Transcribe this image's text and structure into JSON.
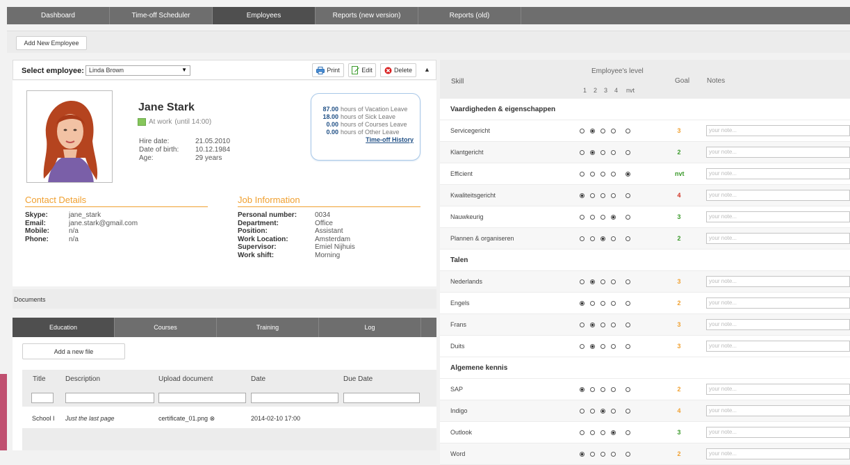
{
  "nav": {
    "tabs": [
      "Dashboard",
      "Time-off Scheduler",
      "Employees",
      "Reports (new version)",
      "Reports (old)"
    ],
    "active": 2
  },
  "toolbar": {
    "add_employee": "Add New Employee"
  },
  "selector": {
    "label": "Select employee:",
    "value": "Linda Brown",
    "print": "Print",
    "edit": "Edit",
    "delete": "Delete",
    "collapse": "▲"
  },
  "profile": {
    "name": "Jane Stark",
    "status": "At work",
    "status_until": "(until 14:00)",
    "hire_label": "Hire date:",
    "hire": "21.05.2010",
    "dob_label": "Date of birth:",
    "dob": "10.12.1984",
    "age_label": "Age:",
    "age": "29 years"
  },
  "leave": {
    "rows": [
      {
        "hours": "87.00",
        "text": "hours of Vacation Leave"
      },
      {
        "hours": "18.00",
        "text": "hours of Sick Leave"
      },
      {
        "hours": "0.00",
        "text": "hours of Courses Leave"
      },
      {
        "hours": "0.00",
        "text": "hours of Other Leave"
      }
    ],
    "history_link": "Time-off History"
  },
  "contact": {
    "title": "Contact Details",
    "skype_k": "Skype:",
    "skype": "jane_stark",
    "email_k": "Email:",
    "email": "jane.stark@gmail.com",
    "mobile_k": "Mobile:",
    "mobile": "n/a",
    "phone_k": "Phone:",
    "phone": "n/a"
  },
  "job": {
    "title": "Job Information",
    "pn_k": "Personal number:",
    "pn": "0034",
    "dept_k": "Department:",
    "dept": "Office",
    "pos_k": "Position:",
    "pos": "Assistant",
    "loc_k": "Work Location:",
    "loc": "Amsterdam",
    "sup_k": "Supervisor:",
    "sup": "Emiel Nijhuis",
    "shift_k": "Work shift:",
    "shift": "Morning"
  },
  "documents": {
    "title": "Documents",
    "tabs": [
      "Education",
      "Courses",
      "Training",
      "Log"
    ],
    "active_tab": 0,
    "add_file": "Add a new file",
    "headers": [
      "Title",
      "Description",
      "Upload document",
      "Date",
      "Due Date"
    ],
    "row": {
      "title": "School I",
      "description": "Just the last page",
      "upload": "certificate_01.png",
      "date": "2014-02-10 17:00"
    }
  },
  "skills": {
    "header": {
      "skill": "Skill",
      "level": "Employee's level",
      "levels": [
        "1",
        "2",
        "3",
        "4",
        "nvt"
      ],
      "goal": "Goal",
      "notes": "Notes"
    },
    "note_placeholder": "your note...",
    "goal_colors": {
      "orange": "#f0a030",
      "green": "#3a9a2a",
      "red": "#d03020"
    },
    "rows": [
      {
        "type": "cat",
        "name": "Vaardigheden & eigenschappen"
      },
      {
        "type": "skill",
        "name": "Servicegericht",
        "level": 2,
        "goal": "3",
        "goal_color": "orange"
      },
      {
        "type": "skill",
        "name": "Klantgericht",
        "level": 2,
        "goal": "2",
        "goal_color": "green"
      },
      {
        "type": "skill",
        "name": "Efficient",
        "level": 5,
        "goal": "nvt",
        "goal_color": "green"
      },
      {
        "type": "skill",
        "name": "Kwaliteitsgericht",
        "level": 1,
        "goal": "4",
        "goal_color": "red"
      },
      {
        "type": "skill",
        "name": "Nauwkeurig",
        "level": 4,
        "goal": "3",
        "goal_color": "green"
      },
      {
        "type": "skill",
        "name": "Plannen & organiseren",
        "level": 3,
        "goal": "2",
        "goal_color": "green"
      },
      {
        "type": "cat",
        "name": "Talen"
      },
      {
        "type": "skill",
        "name": "Nederlands",
        "level": 2,
        "goal": "3",
        "goal_color": "orange"
      },
      {
        "type": "skill",
        "name": "Engels",
        "level": 1,
        "goal": "2",
        "goal_color": "orange"
      },
      {
        "type": "skill",
        "name": "Frans",
        "level": 2,
        "goal": "3",
        "goal_color": "orange"
      },
      {
        "type": "skill",
        "name": "Duits",
        "level": 2,
        "goal": "3",
        "goal_color": "orange"
      },
      {
        "type": "cat",
        "name": "Algemene kennis"
      },
      {
        "type": "skill",
        "name": "SAP",
        "level": 1,
        "goal": "2",
        "goal_color": "orange"
      },
      {
        "type": "skill",
        "name": "Indigo",
        "level": 3,
        "goal": "4",
        "goal_color": "orange"
      },
      {
        "type": "skill",
        "name": "Outlook",
        "level": 4,
        "goal": "3",
        "goal_color": "green"
      },
      {
        "type": "skill",
        "name": "Word",
        "level": 1,
        "goal": "2",
        "goal_color": "orange"
      }
    ]
  }
}
